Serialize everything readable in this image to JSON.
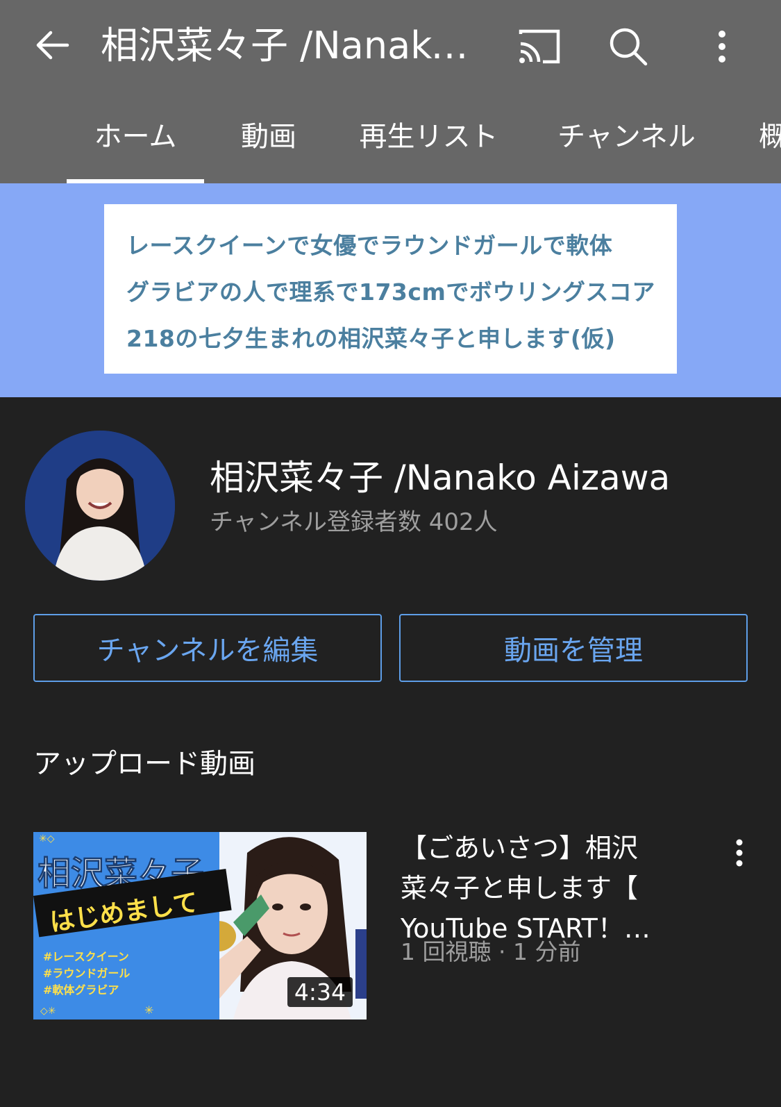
{
  "appbar": {
    "title": "相沢菜々子 /Nanako…",
    "icons": [
      "back-arrow-icon",
      "cast-icon",
      "search-icon",
      "more-vert-icon"
    ]
  },
  "tabs": [
    {
      "label": "ホーム",
      "active": true
    },
    {
      "label": "動画",
      "active": false
    },
    {
      "label": "再生リスト",
      "active": false
    },
    {
      "label": "チャンネル",
      "active": false
    },
    {
      "label": "概",
      "active": false
    }
  ],
  "banner": {
    "lines": [
      "レースクイーンで女優でラウンドガールで軟体",
      "グラビアの人で理系で173cmでボウリングスコア",
      "218の七夕生まれの相沢菜々子と申します(仮)"
    ],
    "background_color": "#86a8f6",
    "text_color": "#4b7f9f"
  },
  "channel": {
    "name": "相沢菜々子 /Nanako Aizawa",
    "subscribers": "チャンネル登録者数 402人"
  },
  "actions": {
    "edit_label": "チャンネルを編集",
    "manage_label": "動画を管理",
    "accent_color": "#5e9ee8"
  },
  "uploads": {
    "section_title": "アップロード動画",
    "videos": [
      {
        "title_lines": [
          "【ごあいさつ】相沢",
          "菜々子と申します【",
          "YouTube START！…"
        ],
        "meta": "1 回視聴 · 1 分前",
        "duration": "4:34",
        "thumbnail": {
          "title": "相沢菜々子",
          "subtitle": "はじめまして",
          "tags": [
            "#レースクイーン",
            "#ラウンドガール",
            "#軟体グラビア"
          ]
        }
      }
    ]
  }
}
